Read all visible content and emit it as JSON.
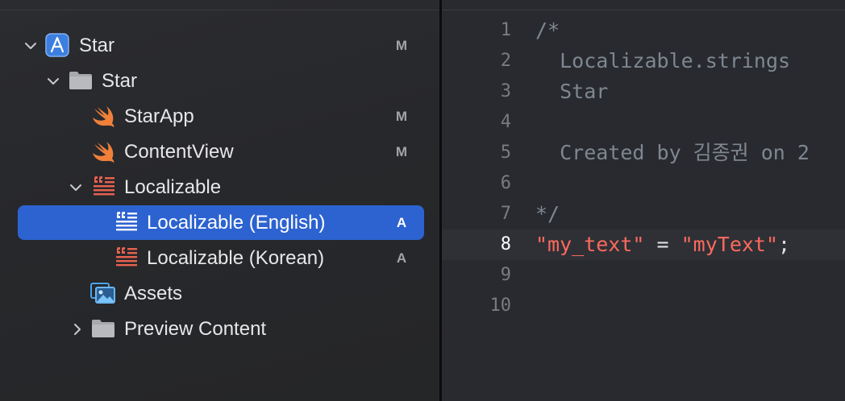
{
  "navigator": {
    "items": [
      {
        "label": "Star",
        "badge": "M",
        "icon": "xcode-project-icon",
        "chevron": "down"
      },
      {
        "label": "Star",
        "badge": "",
        "icon": "folder-icon",
        "chevron": "down"
      },
      {
        "label": "StarApp",
        "badge": "M",
        "icon": "swift-file-icon",
        "chevron": ""
      },
      {
        "label": "ContentView",
        "badge": "M",
        "icon": "swift-file-icon",
        "chevron": ""
      },
      {
        "label": "Localizable",
        "badge": "",
        "icon": "strings-file-icon",
        "chevron": "down"
      },
      {
        "label": "Localizable (English)",
        "badge": "A",
        "icon": "strings-file-icon",
        "chevron": "",
        "selected": true
      },
      {
        "label": "Localizable (Korean)",
        "badge": "A",
        "icon": "strings-file-icon",
        "chevron": ""
      },
      {
        "label": "Assets",
        "badge": "",
        "icon": "asset-catalog-icon",
        "chevron": ""
      },
      {
        "label": "Preview Content",
        "badge": "",
        "icon": "folder-icon",
        "chevron": "right"
      }
    ]
  },
  "editor": {
    "current_line": 8,
    "lines": [
      {
        "num": "1",
        "parts": [
          {
            "t": "/*",
            "c": "comment"
          }
        ]
      },
      {
        "num": "2",
        "parts": [
          {
            "t": "  Localizable.strings",
            "c": "comment"
          }
        ]
      },
      {
        "num": "3",
        "parts": [
          {
            "t": "  Star",
            "c": "comment"
          }
        ]
      },
      {
        "num": "4",
        "parts": []
      },
      {
        "num": "5",
        "parts": [
          {
            "t": "  Created by 김종권 on 2",
            "c": "comment"
          }
        ]
      },
      {
        "num": "6",
        "parts": []
      },
      {
        "num": "7",
        "parts": [
          {
            "t": "*/",
            "c": "comment"
          }
        ]
      },
      {
        "num": "8",
        "parts": [
          {
            "t": "\"my_text\"",
            "c": "str"
          },
          {
            "t": " = ",
            "c": "op"
          },
          {
            "t": "\"myText\"",
            "c": "str"
          },
          {
            "t": ";",
            "c": "op"
          }
        ]
      },
      {
        "num": "9",
        "parts": []
      },
      {
        "num": "10",
        "parts": []
      }
    ]
  },
  "colors": {
    "selection": "#2d63d0",
    "string": "#fc6a5d",
    "comment": "#7e8791",
    "swift_orange": "#f0803a",
    "strings_red": "#e8614f",
    "folder_gray": "#a8a9ad",
    "project_blue": "#4a8fe8"
  }
}
